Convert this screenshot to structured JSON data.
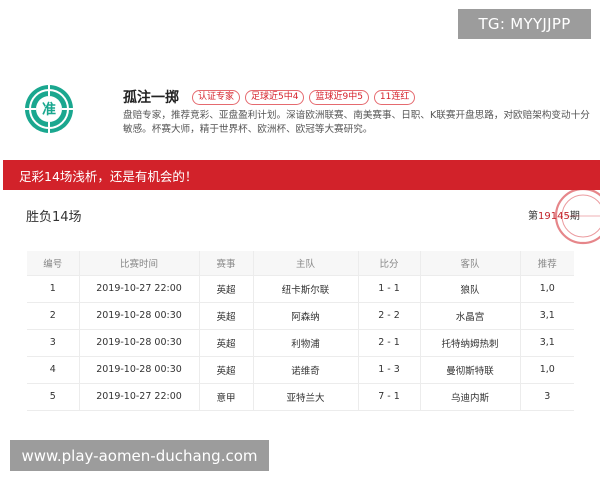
{
  "watermark_tg": "TG: MYYJJPP",
  "profile": {
    "logo_char": "准",
    "name": "孤注一掷",
    "tags": [
      "认证专家",
      "足球近5中4",
      "篮球近9中5",
      "11连红"
    ],
    "description": "盘赔专家，推荐竞彩、亚盘盈利计划。深谙欧洲联赛、南美赛事、日职、K联赛开盘思路，对欧赔架构变动十分敏感。杯赛大师，精于世界杯、欧洲杯、欧冠等大赛研究。"
  },
  "banner_text": "足彩14场浅析，还是有机会的！",
  "section": {
    "title": "胜负14场",
    "issue_prefix": "第",
    "issue_number": "19145",
    "issue_suffix": "期"
  },
  "table": {
    "headers": [
      "编号",
      "比赛时间",
      "赛事",
      "主队",
      "比分",
      "客队",
      "推荐"
    ],
    "rows": [
      [
        "1",
        "2019-10-27 22:00",
        "英超",
        "纽卡斯尔联",
        "1 - 1",
        "狼队",
        "1,0"
      ],
      [
        "2",
        "2019-10-28 00:30",
        "英超",
        "阿森纳",
        "2 - 2",
        "水晶宫",
        "3,1"
      ],
      [
        "3",
        "2019-10-28 00:30",
        "英超",
        "利物浦",
        "2 - 1",
        "托特纳姆热刺",
        "3,1"
      ],
      [
        "4",
        "2019-10-28 00:30",
        "英超",
        "诺维奇",
        "1 - 3",
        "曼彻斯特联",
        "1,0"
      ],
      [
        "5",
        "2019-10-27 22:00",
        "意甲",
        "亚特兰大",
        "7 - 1",
        "乌迪内斯",
        "3"
      ]
    ]
  },
  "watermark_site": "www.play-aomen-duchang.com",
  "colors": {
    "accent_red": "#d2222a",
    "logo_teal": "#1aa78f"
  }
}
